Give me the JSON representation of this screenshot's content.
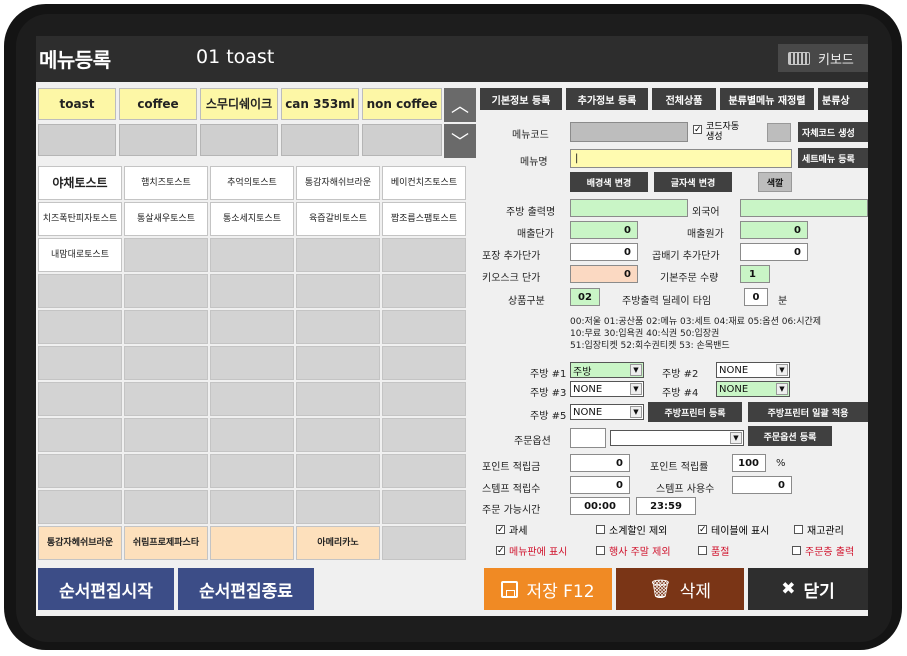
{
  "window": {
    "title": "메뉴등록",
    "subtitle": "01 toast",
    "keyboard_label": "키보드"
  },
  "categories": [
    {
      "label": "toast"
    },
    {
      "label": "coffee"
    },
    {
      "label": "스무디쉐이크"
    },
    {
      "label": "can 353ml"
    },
    {
      "label": "non coffee"
    }
  ],
  "menu_items": {
    "r1": [
      "야채토스트",
      "햄치즈토스트",
      "추억의토스트",
      "통감자해쉬브라운",
      "베이컨치즈토스트"
    ],
    "r2": [
      "치즈폭탄피자토스트",
      "통살새우토스트",
      "통소세지토스트",
      "육즙갈비토스트",
      "짭조름스팸토스트"
    ],
    "r3": [
      "내맘대로토스트"
    ],
    "r10": [
      "통감자헤쉬브라운",
      "쉬림프로제파스타",
      "",
      "아메리카노"
    ]
  },
  "tabs": [
    "기본정보 등록",
    "추가정보 등록",
    "전체상품",
    "분류별메뉴 재정렬",
    "분류상"
  ],
  "form": {
    "menu_code_label": "메뉴코드",
    "auto_code_label": "코드자동생성",
    "custom_code_btn": "자체코드 생성",
    "menu_name_label": "메뉴명",
    "set_menu_btn": "세트메뉴 등록",
    "bg_color_btn": "배경색 변경",
    "text_color_btn": "글자색 변경",
    "color_btn": "색깔",
    "kitchen_name_label": "주방 출력명",
    "foreign_label": "외국어",
    "sale_price_label": "매출단가",
    "sale_price": "0",
    "cost_label": "매출원가",
    "cost": "0",
    "pack_price_label": "포장 추가단가",
    "pack_price": "0",
    "double_price_label": "곱배기 추가단가",
    "double_price": "0",
    "kiosk_price_label": "키오스크 단가",
    "kiosk_price": "0",
    "base_qty_label": "기본주문 수량",
    "base_qty": "1",
    "product_type_label": "상품구분",
    "product_type": "02",
    "delay_label": "주방출력 딜레이 타임",
    "delay": "0",
    "delay_unit": "분",
    "type_note_1": "00:저울 01:공산품 02:메뉴 03:세트 04:재료 05:옵션 06:시간제",
    "type_note_2": "10:무료 30:입욕권 40:식권 50:입장권",
    "type_note_3": "51:입장티켓 52:회수권티켓 53: 손목밴드",
    "kitchen1_label": "주방 #1",
    "kitchen1": "주방",
    "kitchen2_label": "주방 #2",
    "kitchen2": "NONE",
    "kitchen3_label": "주방 #3",
    "kitchen3": "NONE",
    "kitchen4_label": "주방 #4",
    "kitchen4": "NONE",
    "kitchen5_label": "주방 #5",
    "kitchen5": "NONE",
    "kitchen_printer_btn": "주방프린터 등록",
    "kitchen_printer_all_btn": "주방프린터 일괄 적용",
    "order_option_label": "주문옵션",
    "order_option_btn": "주문옵션 등록",
    "point_amt_label": "포인트 적립금",
    "point_amt": "0",
    "point_rate_label": "포인트 적립률",
    "point_rate": "100",
    "point_rate_unit": "%",
    "stamp_save_label": "스템프 적립수",
    "stamp_save": "0",
    "stamp_use_label": "스템프 사용수",
    "stamp_use": "0",
    "order_time_label": "주문 가능시간",
    "order_time_from": "00:00",
    "order_time_to": "23:59",
    "chk_tax": "과세",
    "chk_sub_discount": "소계할인 제외",
    "chk_table_show": "테이블에 표시",
    "chk_inventory": "재고관리",
    "chk_menu_show": "메뉴판에 표시",
    "chk_event_weekend": "행사 주말 제외",
    "chk_soldout": "품절",
    "chk_order_print": "주문층 출력"
  },
  "buttons": {
    "order_edit_start": "순서편집시작",
    "order_edit_end": "순서편집종료",
    "save": "저장 F12",
    "delete": "삭제",
    "close": "닫기"
  }
}
